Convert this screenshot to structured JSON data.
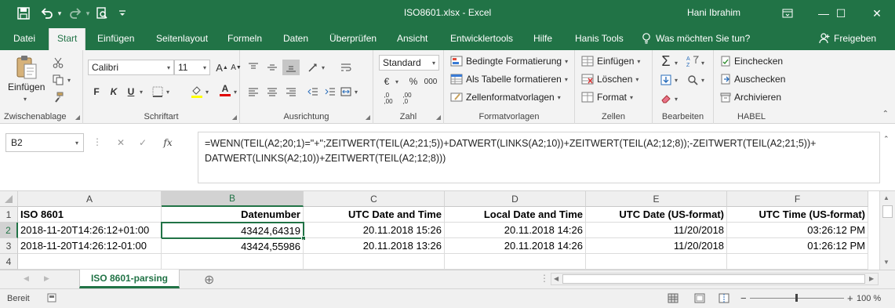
{
  "window": {
    "title": "ISO8601.xlsx  -  Excel",
    "user": "Hani Ibrahim",
    "controls": {
      "ribbon_display": "⊡",
      "minimize": "—",
      "maximize": "☐",
      "close": "✕"
    }
  },
  "quick_access": {
    "save": "💾",
    "undo": "↶",
    "redo": "↷",
    "preview": "🔍",
    "customize": "▾"
  },
  "tabs": [
    "Datei",
    "Start",
    "Einfügen",
    "Seitenlayout",
    "Formeln",
    "Daten",
    "Überprüfen",
    "Ansicht",
    "Entwicklertools",
    "Hilfe",
    "Hanis Tools"
  ],
  "active_tab": "Start",
  "tell_me": "Was möchten Sie tun?",
  "share": "Freigeben",
  "ribbon": {
    "clipboard": {
      "label": "Zwischenablage",
      "paste": "Einfügen"
    },
    "font": {
      "label": "Schriftart",
      "name": "Calibri",
      "size": "11",
      "bold": "F",
      "italic": "K",
      "underline": "U",
      "grow": "A",
      "shrink": "A",
      "border": "⊞",
      "fill": "A",
      "color": "A"
    },
    "alignment": {
      "label": "Ausrichtung"
    },
    "number": {
      "label": "Zahl",
      "format": "Standard",
      "currency": "€",
      "percent": "%",
      "thousands": "000",
      "inc_dec": ",00\n→,0",
      "dec_dec": ",00\n→,0"
    },
    "styles": {
      "label": "Formatvorlagen",
      "conditional": "Bedingte Formatierung",
      "as_table": "Als Tabelle formatieren",
      "cell_styles": "Zellenformatvorlagen"
    },
    "cells": {
      "label": "Zellen",
      "insert": "Einfügen",
      "delete": "Löschen",
      "format": "Format"
    },
    "editing": {
      "label": "Bearbeiten",
      "sum": "Σ",
      "sort": "A→Z",
      "fill": "↓",
      "find": "🔍",
      "clear": "◆"
    },
    "habel": {
      "label": "HABEL",
      "checkin": "Einchecken",
      "checkout": "Auschecken",
      "archive": "Archivieren"
    }
  },
  "formula_bar": {
    "name_box": "B2",
    "cancel": "✕",
    "enter": "✓",
    "fx": "fx",
    "formula": "=WENN(TEIL(A2;20;1)=\"+\";ZEITWERT(TEIL(A2;21;5))+DATWERT(LINKS(A2;10))+ZEITWERT(TEIL(A2;12;8));-ZEITWERT(TEIL(A2;21;5))+ DATWERT(LINKS(A2;10))+ZEITWERT(TEIL(A2;12;8)))"
  },
  "sheet": {
    "columns": [
      "A",
      "B",
      "C",
      "D",
      "E",
      "F"
    ],
    "row_numbers": [
      "1",
      "2",
      "3",
      "4"
    ],
    "rows": [
      [
        "ISO 8601",
        "Datenumber",
        "UTC Date and Time",
        "Local Date and Time",
        "UTC Date (US-format)",
        "UTC Time (US-format)"
      ],
      [
        "2018-11-20T14:26:12+01:00",
        "43424,64319",
        "20.11.2018 15:26",
        "20.11.2018 14:26",
        "11/20/2018",
        "03:26:12 PM"
      ],
      [
        "2018-11-20T14:26:12-01:00",
        "43424,55986",
        "20.11.2018 13:26",
        "20.11.2018 14:26",
        "11/20/2018",
        "01:26:12 PM"
      ]
    ],
    "selected_cell": "B2"
  },
  "sheet_tabs": {
    "active": "ISO 8601-parsing",
    "add": "⊕",
    "prev": "◀",
    "next": "▶"
  },
  "status": {
    "mode": "Bereit",
    "zoom": "100 %",
    "zoom_out": "−",
    "zoom_in": "+"
  }
}
